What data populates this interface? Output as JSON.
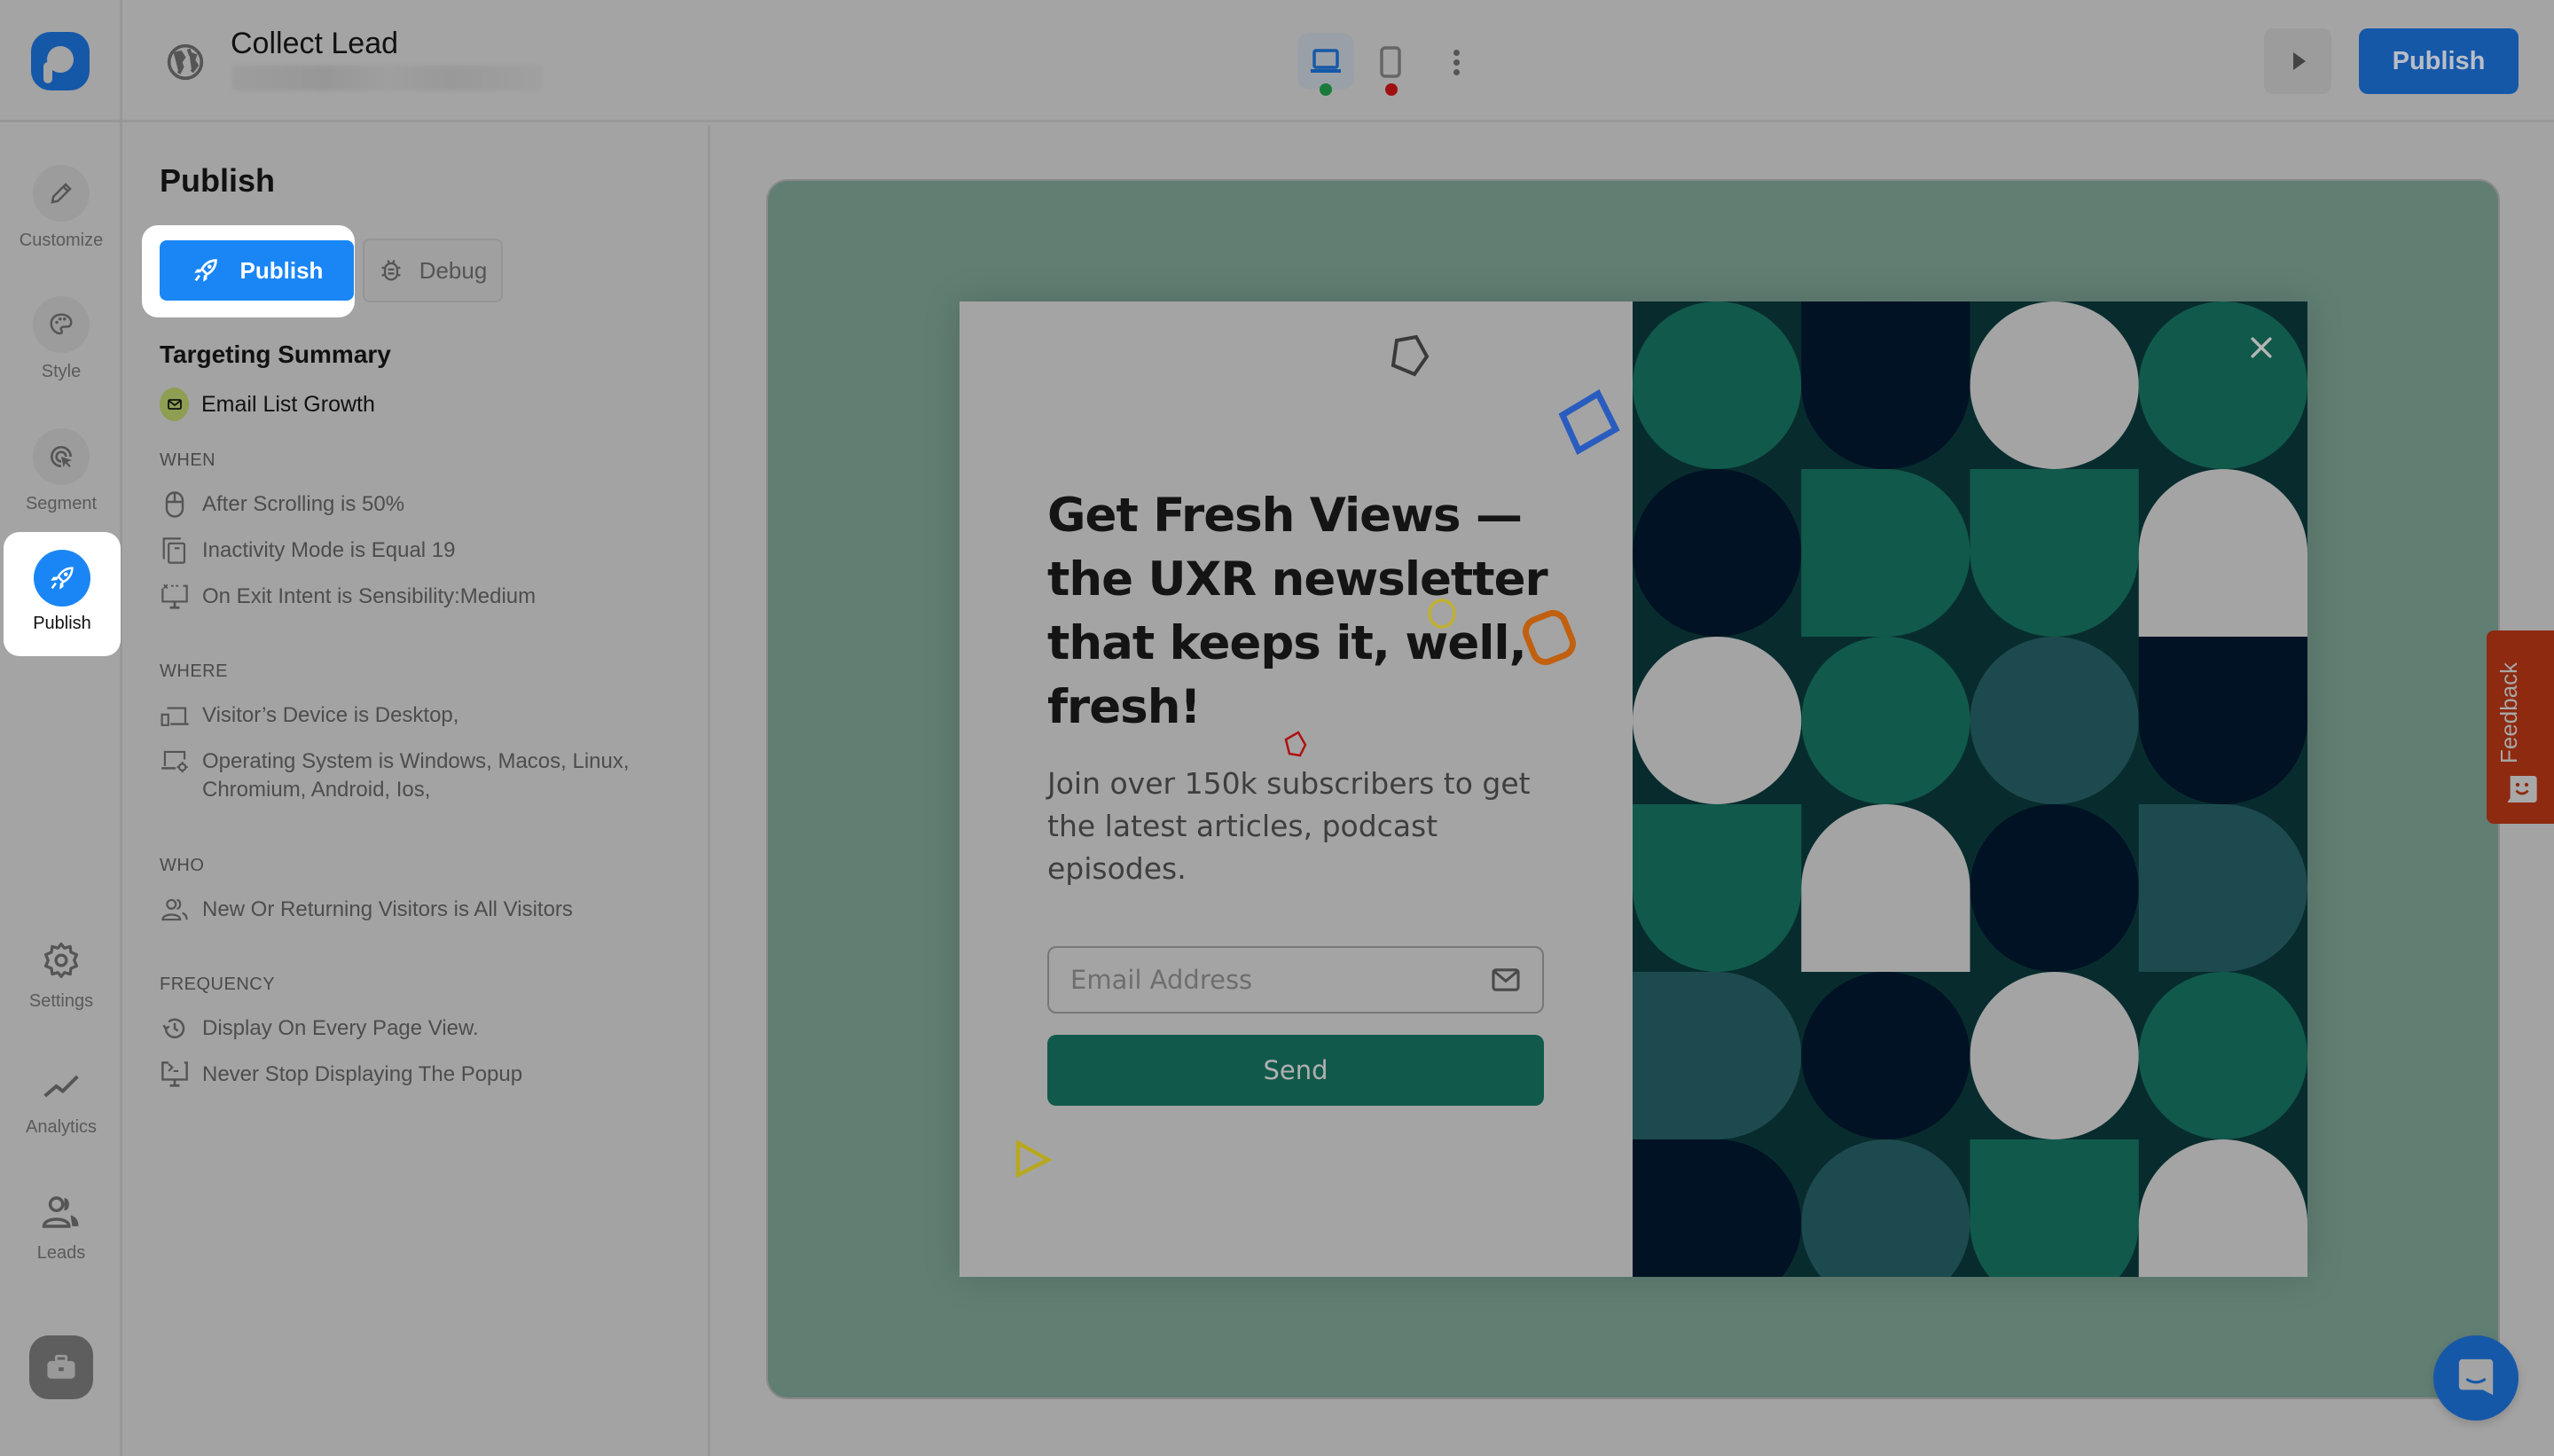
{
  "header": {
    "title": "Collect Lead",
    "publish_label": "Publish",
    "devices": [
      {
        "name": "desktop",
        "status_color": "#1a7a3c",
        "active": true
      },
      {
        "name": "mobile",
        "status_color": "#a01010",
        "active": false
      }
    ]
  },
  "rail": {
    "items": [
      {
        "label": "Customize",
        "icon": "pencil-icon"
      },
      {
        "label": "Style",
        "icon": "palette-icon"
      },
      {
        "label": "Segment",
        "icon": "target-cursor-icon"
      },
      {
        "label": "Publish",
        "icon": "rocket-icon",
        "active": true
      },
      {
        "label": "Settings",
        "icon": "gear-icon"
      },
      {
        "label": "Analytics",
        "icon": "trend-line-icon"
      },
      {
        "label": "Leads",
        "icon": "users-icon"
      }
    ]
  },
  "panel": {
    "title": "Publish",
    "publish_button": "Publish",
    "debug_button": "Debug",
    "targeting_title": "Targeting Summary",
    "goal": "Email List Growth",
    "sections": [
      {
        "heading": "WHEN",
        "conditions": [
          {
            "icon": "mouse-icon",
            "text": "After Scrolling is 50%"
          },
          {
            "icon": "pages-icon",
            "text": "Inactivity Mode is Equal 19"
          },
          {
            "icon": "exit-monitor-icon",
            "text": "On Exit Intent is Sensibility:Medium"
          }
        ]
      },
      {
        "heading": "WHERE",
        "conditions": [
          {
            "icon": "devices-icon",
            "text": "Visitor’s Device is Desktop,"
          },
          {
            "icon": "laptop-gear-icon",
            "text": "Operating System is Windows, Macos, Linux, Chromium, Android, Ios,"
          }
        ]
      },
      {
        "heading": "WHO",
        "conditions": [
          {
            "icon": "users-icon",
            "text": "New Or Returning Visitors is All Visitors"
          }
        ]
      },
      {
        "heading": "FREQUENCY",
        "conditions": [
          {
            "icon": "history-icon",
            "text": "Display On Every Page View."
          },
          {
            "icon": "monitor-terminal-icon",
            "text": "Never Stop Displaying The Popup"
          }
        ]
      }
    ]
  },
  "popup": {
    "headline": "Get Fresh Views — the UXR newsletter that keeps it, well, fresh!",
    "subtext": "Join over 150k subscribers to get the latest articles, podcast episodes.",
    "email_placeholder": "Email Address",
    "email_value": "",
    "send_label": "Send",
    "colors": {
      "button": "#115a4b",
      "pattern_bg": "#082c2e",
      "green": "#115a4b",
      "navy": "#001223",
      "teal": "#1d4a4e",
      "light": "#a4a4a4"
    }
  },
  "feedback": {
    "label": "Feedback",
    "color": "#8e2a10"
  },
  "canvas": {
    "background": "#617e73"
  }
}
